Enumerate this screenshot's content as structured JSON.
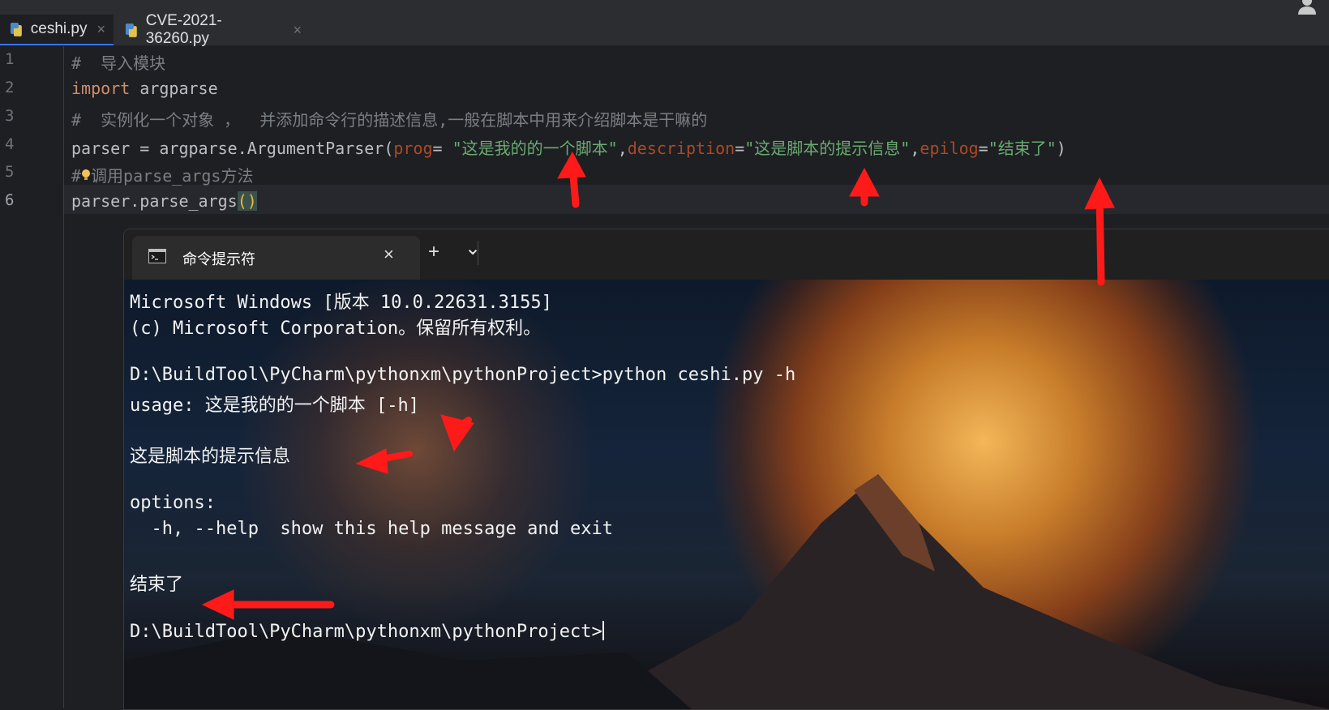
{
  "ide": {
    "tabs": [
      {
        "label": "ceshi.py",
        "close": "×"
      },
      {
        "label": "CVE-2021-36260.py",
        "close": "×"
      }
    ],
    "line_numbers": [
      "1",
      "2",
      "3",
      "4",
      "5",
      "6"
    ],
    "code": {
      "line1_comment": "#  导入模块",
      "line2_kw": "import",
      "line2_rest": " argparse",
      "line3_comment": "#  实例化一个对象 ，  并添加命令行的描述信息,一般在脚本中用来介绍脚本是干嘛的",
      "line4_a": "parser = argparse.ArgumentParser(",
      "line4_p1": "prog",
      "line4_eq1": "= ",
      "line4_s1": "\"这是我的的一个脚本\"",
      "line4_c1": ",",
      "line4_p2": "description",
      "line4_eq2": "=",
      "line4_s2": "\"这是脚本的提示信息\"",
      "line4_c2": ",",
      "line4_p3": "epilog",
      "line4_eq3": "=",
      "line4_s3": "\"结束了\"",
      "line4_end": ")",
      "line5_hash": "#",
      "line5_rest": "调用parse_args方法",
      "line6_a": "parser.parse_args",
      "line6_b": "()"
    }
  },
  "terminal": {
    "tab_title": "命令提示符",
    "tab_close": "×",
    "new_tab": "+",
    "dropdown": "⌄",
    "lines": [
      "Microsoft Windows [版本 10.0.22631.3155]",
      "(c) Microsoft Corporation。保留所有权利。",
      "",
      "D:\\BuildTool\\PyCharm\\pythonxm\\pythonProject>python ceshi.py -h",
      "usage: 这是我的的一个脚本 [-h]",
      "",
      "这是脚本的提示信息",
      "",
      "options:",
      "  -h, --help  show this help message and exit",
      "",
      "结束了",
      "",
      "D:\\BuildTool\\PyCharm\\pythonxm\\pythonProject>"
    ]
  },
  "colors": {
    "editor_bg": "#1e1f22",
    "keyword": "#cf8e6d",
    "param": "#aa4926",
    "string": "#6aab73",
    "comment": "#7a7e85",
    "annotation_arrow": "#ff1a1a"
  }
}
